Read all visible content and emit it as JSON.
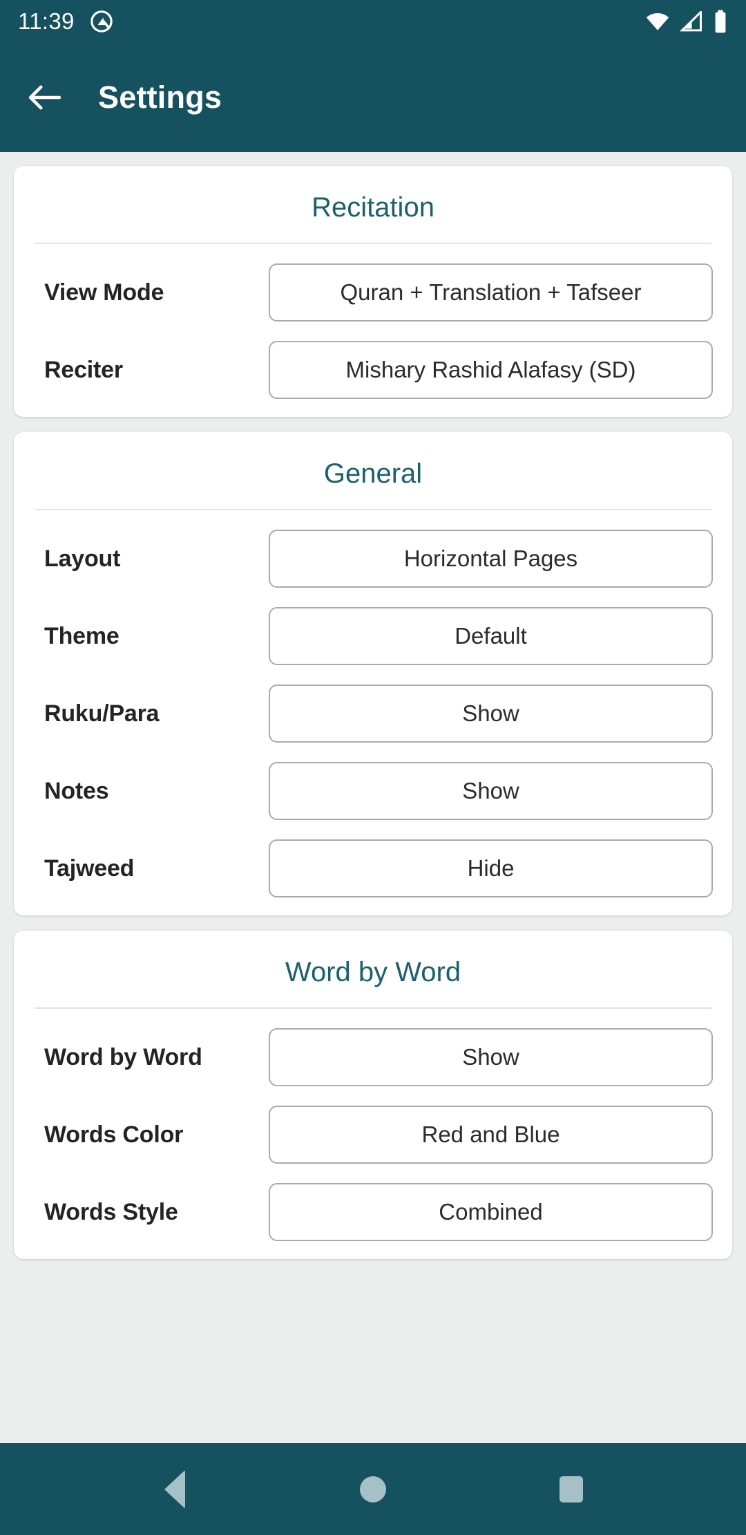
{
  "status_bar": {
    "time": "11:39",
    "notification_icon": "app-notification-icon",
    "wifi_icon": "wifi-icon",
    "signal_icon": "cellular-signal-icon",
    "battery_icon": "battery-full-icon"
  },
  "app_bar": {
    "back_icon": "back-arrow-icon",
    "title": "Settings"
  },
  "theme": {
    "primary": "#165160",
    "accent": "#1a6070",
    "background": "#eceded",
    "card": "#ffffff",
    "nav_icon": "#a6c0c8"
  },
  "sections": [
    {
      "title": "Recitation",
      "rows": [
        {
          "label": "View Mode",
          "value": "Quran + Translation + Tafseer"
        },
        {
          "label": "Reciter",
          "value": "Mishary Rashid Alafasy (SD)"
        }
      ]
    },
    {
      "title": "General",
      "rows": [
        {
          "label": "Layout",
          "value": "Horizontal Pages"
        },
        {
          "label": "Theme",
          "value": "Default"
        },
        {
          "label": "Ruku/Para",
          "value": "Show"
        },
        {
          "label": "Notes",
          "value": "Show"
        },
        {
          "label": "Tajweed",
          "value": "Hide"
        }
      ]
    },
    {
      "title": "Word by Word",
      "rows": [
        {
          "label": "Word by Word",
          "value": "Show"
        },
        {
          "label": "Words Color",
          "value": "Red and Blue"
        },
        {
          "label": "Words Style",
          "value": "Combined"
        }
      ]
    }
  ],
  "nav_bar": {
    "back_label": "back-nav-button",
    "home_label": "home-nav-button",
    "recents_label": "recents-nav-button"
  }
}
